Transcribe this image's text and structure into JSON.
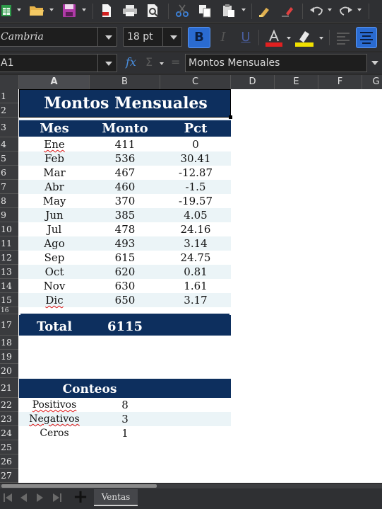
{
  "toolbar": {
    "new_icon": "spreadsheet-new-icon",
    "open_icon": "folder-open-icon",
    "save_icon": "save-icon",
    "export_pdf_icon": "export-pdf-icon",
    "print_icon": "print-icon",
    "print_preview_icon": "print-preview-icon",
    "cut_icon": "cut-icon",
    "copy_icon": "copy-icon",
    "paste_icon": "paste-icon",
    "clone_format_icon": "clone-formatting-icon",
    "clear_format_icon": "clear-formatting-icon",
    "undo_icon": "undo-icon",
    "redo_icon": "redo-icon"
  },
  "format": {
    "font_name": "Cambria",
    "font_size": "18 pt",
    "bold_label": "B",
    "italic_label": "I",
    "underline_label": "U",
    "font_color": "#e02020",
    "highlight_color": "#f0e000"
  },
  "formula_bar": {
    "name_box": "A1",
    "fx_label": "fx",
    "sigma_label": "Σ",
    "equals_label": "=",
    "content": "Montos Mensuales"
  },
  "columns": [
    "A",
    "B",
    "C",
    "D",
    "E",
    "F",
    "G"
  ],
  "rows": [
    "1",
    "2",
    "3",
    "4",
    "5",
    "6",
    "7",
    "8",
    "9",
    "10",
    "11",
    "12",
    "13",
    "14",
    "15",
    "16",
    "17",
    "18",
    "19",
    "20",
    "21",
    "22",
    "23",
    "24",
    "25",
    "26",
    "27"
  ],
  "sheet": {
    "title": "Montos Mensuales",
    "headers": [
      "Mes",
      "Monto",
      "Pct"
    ],
    "data": [
      {
        "mes": "Ene",
        "monto": "411",
        "pct": "0"
      },
      {
        "mes": "Feb",
        "monto": "536",
        "pct": "30.41"
      },
      {
        "mes": "Mar",
        "monto": "467",
        "pct": "-12.87"
      },
      {
        "mes": "Abr",
        "monto": "460",
        "pct": "-1.5"
      },
      {
        "mes": "May",
        "monto": "370",
        "pct": "-19.57"
      },
      {
        "mes": "Jun",
        "monto": "385",
        "pct": "4.05"
      },
      {
        "mes": "Jul",
        "monto": "478",
        "pct": "24.16"
      },
      {
        "mes": "Ago",
        "monto": "493",
        "pct": "3.14"
      },
      {
        "mes": "Sep",
        "monto": "615",
        "pct": "24.75"
      },
      {
        "mes": "Oct",
        "monto": "620",
        "pct": "0.81"
      },
      {
        "mes": "Nov",
        "monto": "630",
        "pct": "1.61"
      },
      {
        "mes": "Dic",
        "monto": "650",
        "pct": "3.17"
      }
    ],
    "total_label": "Total",
    "total_value": "6115",
    "conteos_title": "Conteos",
    "conteos": [
      {
        "label": "Positivos",
        "value": "8"
      },
      {
        "label": "Negativos",
        "value": "3"
      },
      {
        "label": "Ceros",
        "value": "1"
      }
    ]
  },
  "tabs": {
    "active_sheet": "Ventas",
    "add_label": "+"
  },
  "colors": {
    "header_band": "#0d2f5e",
    "light_row": "#ebf4f7",
    "accent_button": "#2a6bd1"
  }
}
